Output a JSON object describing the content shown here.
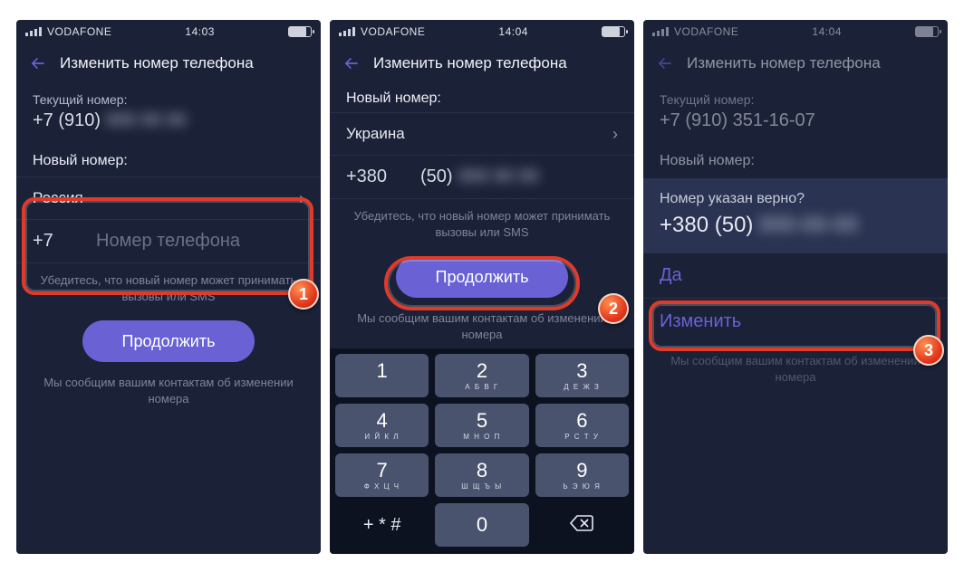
{
  "status": {
    "carrier": "VODAFONE",
    "time1": "14:03",
    "time2": "14:04",
    "time3": "14:04"
  },
  "nav": {
    "title": "Изменить номер телефона"
  },
  "current_label": "Текущий номер:",
  "current_number_prefix": "+7 (910)",
  "current_number_full": "+7 (910) 351-16-07",
  "new_label": "Новый номер:",
  "s1": {
    "country": "Россия",
    "prefix": "+7",
    "placeholder": "Номер телефона"
  },
  "s2": {
    "country": "Украина",
    "prefix": "+380",
    "area": "(50)"
  },
  "hint": "Убедитесь, что новый номер может принимать вызовы или SMS",
  "continue": "Продолжить",
  "notice": "Мы сообщим вашим контактам об изменении номера",
  "s3": {
    "question": "Номер указан верно?",
    "number_prefix": "+380 (50)",
    "yes": "Да",
    "edit": "Изменить"
  },
  "keypad": [
    {
      "d": "1",
      "l": ""
    },
    {
      "d": "2",
      "l": "А Б В Г"
    },
    {
      "d": "3",
      "l": "Д Е Ж З"
    },
    {
      "d": "4",
      "l": "И Й К Л"
    },
    {
      "d": "5",
      "l": "М Н О П"
    },
    {
      "d": "6",
      "l": "Р С Т У"
    },
    {
      "d": "7",
      "l": "Ф Х Ц Ч"
    },
    {
      "d": "8",
      "l": "Ш Щ Ъ Ы"
    },
    {
      "d": "9",
      "l": "Ь Э Ю Я"
    }
  ],
  "badges": {
    "b1": "1",
    "b2": "2",
    "b3": "3"
  }
}
